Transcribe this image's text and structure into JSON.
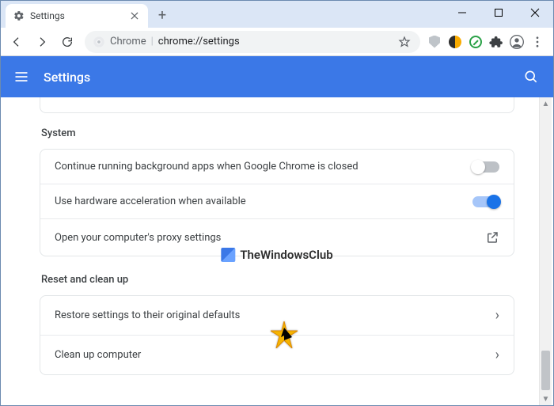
{
  "tab": {
    "title": "Settings"
  },
  "omnibox": {
    "scheme_label": "Chrome",
    "url": "chrome://settings"
  },
  "header": {
    "title": "Settings"
  },
  "sections": {
    "system": {
      "title": "System",
      "rows": {
        "bg_apps": {
          "label": "Continue running background apps when Google Chrome is closed",
          "on": false
        },
        "hw_accel": {
          "label": "Use hardware acceleration when available",
          "on": true
        },
        "proxy": {
          "label": "Open your computer's proxy settings"
        }
      }
    },
    "reset": {
      "title": "Reset and clean up",
      "rows": {
        "restore": {
          "label": "Restore settings to their original defaults"
        },
        "cleanup": {
          "label": "Clean up computer"
        }
      }
    }
  },
  "watermark": {
    "text": "TheWindowsClub"
  }
}
